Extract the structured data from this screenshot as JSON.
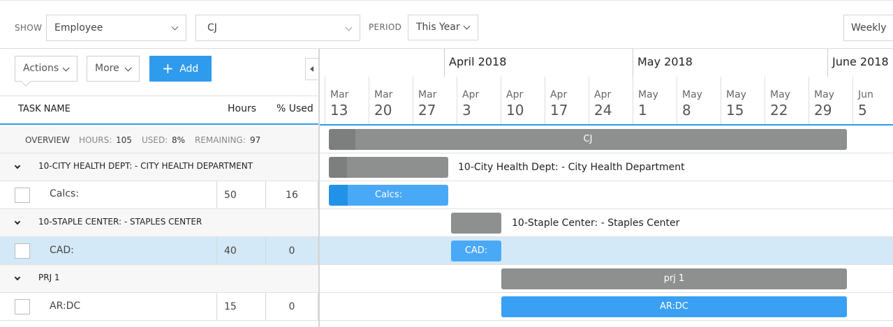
{
  "filters": {
    "show_label": "SHOW",
    "show_value": "Employee",
    "employee_value": "CJ",
    "period_label": "PERIOD",
    "period_value": "This Year",
    "view_value": "Weekly"
  },
  "toolbar": {
    "actions_label": "Actions",
    "more_label": "More",
    "add_label": "Add"
  },
  "columns": {
    "task_name": "TASK NAME",
    "hours": "Hours",
    "used": "% Used"
  },
  "overview": {
    "label": "OVERVIEW",
    "hours_label": "HOURS:",
    "hours_value": "105",
    "used_label": "USED:",
    "used_value": "8%",
    "remaining_label": "REMAINING:",
    "remaining_value": "97"
  },
  "groups": [
    {
      "title": "10-CITY HEALTH DEPT: - CITY HEALTH DEPARTMENT",
      "task": "Calcs:",
      "hours": "50",
      "used": "16"
    },
    {
      "title": "10-STAPLE CENTER: - STAPLES CENTER",
      "task": "CAD:",
      "hours": "40",
      "used": "0"
    },
    {
      "title": "PRJ 1",
      "task": "AR:DC",
      "hours": "15",
      "used": "0"
    }
  ],
  "months": [
    "April 2018",
    "May 2018",
    "June 2018"
  ],
  "weeks": [
    {
      "m": "Mar",
      "d": "13"
    },
    {
      "m": "Mar",
      "d": "20"
    },
    {
      "m": "Mar",
      "d": "27"
    },
    {
      "m": "Apr",
      "d": "3"
    },
    {
      "m": "Apr",
      "d": "10"
    },
    {
      "m": "Apr",
      "d": "17"
    },
    {
      "m": "Apr",
      "d": "24"
    },
    {
      "m": "May",
      "d": "1"
    },
    {
      "m": "May",
      "d": "8"
    },
    {
      "m": "May",
      "d": "15"
    },
    {
      "m": "May",
      "d": "22"
    },
    {
      "m": "May",
      "d": "29"
    },
    {
      "m": "Jun",
      "d": "5"
    }
  ],
  "bars": {
    "overview": "CJ",
    "group1_label": "10-City Health Dept: - City Health Department",
    "task1": "Calcs:",
    "group2_label": "10-Staple Center: - Staples Center",
    "task2": "CAD:",
    "group3": "prj 1",
    "task3": "AR:DC"
  },
  "colors": {
    "accent": "#2f9bec",
    "bar_gray": "#8e9090",
    "bar_blue": "#4aa9f7",
    "selected_row": "#d4e9f7"
  }
}
